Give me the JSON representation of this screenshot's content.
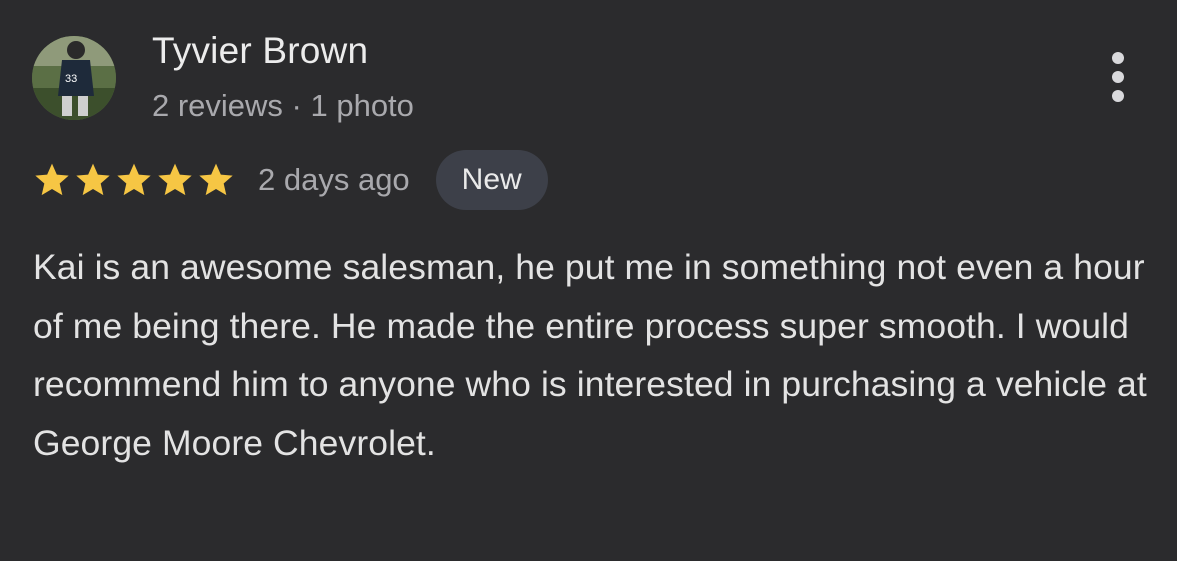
{
  "review": {
    "author": {
      "name": "Tyvier Brown",
      "meta": "2 reviews · 1 photo",
      "avatar_icon": "profile-photo-football-player"
    },
    "rating": {
      "stars": 5,
      "max": 5,
      "star_color": "#f6c644"
    },
    "date": "2 days ago",
    "badge": "New",
    "text": "Kai is an awesome salesman, he put me in something not even a hour of me being there. He made the entire process super smooth. I would recommend him to anyone who is interested in purchasing a vehicle at George Moore Chevrolet.",
    "menu_icon": "more-vert-icon"
  },
  "colors": {
    "background": "#2b2b2d",
    "badge_background": "#3d4049"
  }
}
